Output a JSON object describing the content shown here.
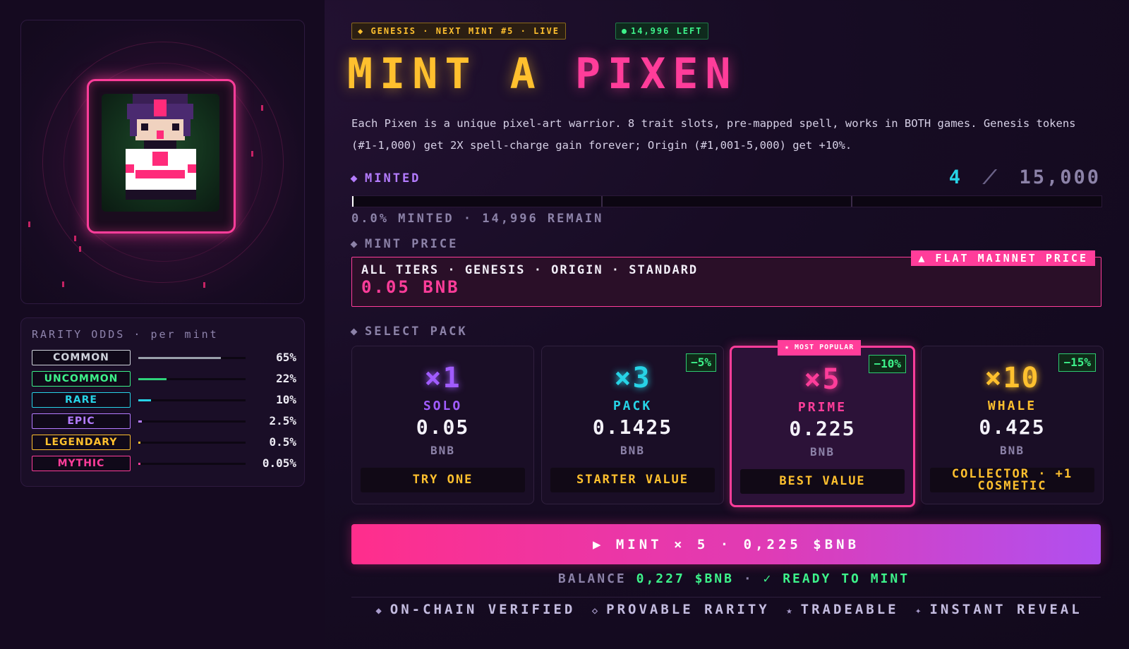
{
  "status": {
    "series_pill": "◆ GENESIS · NEXT MINT #5 · LIVE",
    "left_pill": "14,996 LEFT"
  },
  "title": {
    "part1": "MINT A",
    "part2": "PIXEN"
  },
  "description": "Each Pixen is a unique pixel-art warrior. 8 trait slots, pre-mapped spell, works in BOTH games. Genesis tokens (#1-1,000) get 2X spell-charge gain forever; Origin (#1,001-5,000) get +10%.",
  "minted": {
    "label": "MINTED",
    "count": "4",
    "separator": "⟋",
    "total": "15,000",
    "progress_fraction": 0.0003,
    "progress_text": "0.0% MINTED · 14,996 REMAIN"
  },
  "mint_price": {
    "label": "MINT PRICE",
    "tiers": "ALL TIERS · GENESIS · ORIGIN · STANDARD",
    "value": "0.05 BNB",
    "badge": "▲ FLAT MAINNET PRICE"
  },
  "select_pack_label": "SELECT PACK",
  "packs": [
    {
      "qty": "×1",
      "name": "SOLO",
      "price": "0.05",
      "unit": "BNB",
      "cta": "TRY ONE",
      "discount": "",
      "color": "#a15cff"
    },
    {
      "qty": "×3",
      "name": "PACK",
      "price": "0.1425",
      "unit": "BNB",
      "cta": "STARTER VALUE",
      "discount": "−5%",
      "color": "#27d3e6"
    },
    {
      "qty": "×5",
      "name": "PRIME",
      "price": "0.225",
      "unit": "BNB",
      "cta": "BEST VALUE",
      "discount": "−10%",
      "popular": "★ MOST POPULAR",
      "color": "#ff3d9a"
    },
    {
      "qty": "×10",
      "name": "WHALE",
      "price": "0.425",
      "unit": "BNB",
      "cta": "COLLECTOR · +1 COSMETIC",
      "discount": "−15%",
      "color": "#ffc02e"
    }
  ],
  "mint_button": "▶ MINT × 5 · 0,225 $BNB",
  "balance": {
    "label": "BALANCE",
    "value": "0,227 $BNB",
    "sep": "·",
    "status": "✓ READY TO MINT"
  },
  "features": [
    "ON-CHAIN VERIFIED",
    "PROVABLE RARITY",
    "TRADEABLE",
    "INSTANT REVEAL"
  ],
  "feature_icons": [
    "◆",
    "◇",
    "★",
    "✦"
  ],
  "rarity": {
    "title": "RARITY ODDS",
    "subtitle": "per mint",
    "tiers": [
      {
        "name": "COMMON",
        "pct": "65%",
        "value": 0.65,
        "color": "#cfd3dc",
        "fill": "#9aa0ab"
      },
      {
        "name": "UNCOMMON",
        "pct": "22%",
        "value": 0.22,
        "color": "#3df28a",
        "fill": "#2fd27a"
      },
      {
        "name": "RARE",
        "pct": "10%",
        "value": 0.1,
        "color": "#27d3e6",
        "fill": "#27d3e6"
      },
      {
        "name": "EPIC",
        "pct": "2.5%",
        "value": 0.025,
        "color": "#b47cff",
        "fill": "#b47cff"
      },
      {
        "name": "LEGENDARY",
        "pct": "0.5%",
        "value": 0.005,
        "color": "#ffc02e",
        "fill": "#ffc02e"
      },
      {
        "name": "MYTHIC",
        "pct": "0.05%",
        "value": 0.0005,
        "color": "#ff3d9a",
        "fill": "#ff3d9a"
      }
    ]
  },
  "colors": {
    "accent_pink": "#ff3d9a",
    "accent_gold": "#ffc02e",
    "accent_cyan": "#27d3e6",
    "accent_green": "#3df28a"
  }
}
